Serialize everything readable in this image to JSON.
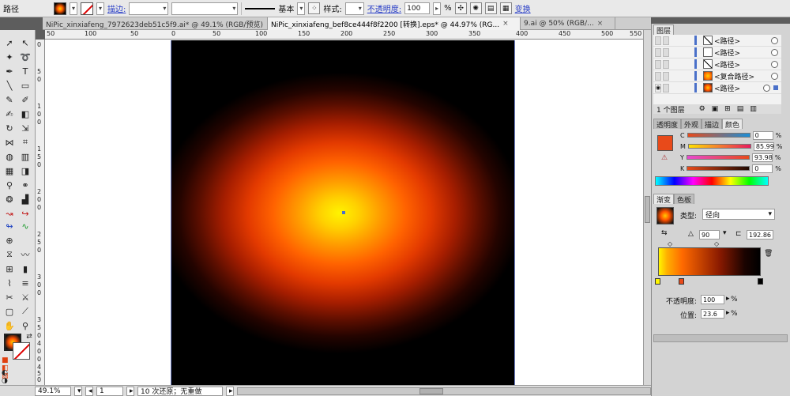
{
  "control_bar": {
    "object_type": "路径",
    "stroke_label": "描边:",
    "stroke_profile": "基本",
    "style_label": "样式:",
    "opacity_label": "不透明度:",
    "opacity_value": "100",
    "opacity_unit": "%",
    "transform_label": "变换"
  },
  "tabs": [
    {
      "label": "NiPic_xinxiafeng_7972623deb51c5f9.ai* @ 49.1% (RGB/预览)",
      "close": "×"
    },
    {
      "label": "NiPic_xinxiafeng_bef8ce444f8f2200 [转换].eps* @ 44.97% (RG...",
      "close": "×"
    },
    {
      "label": "9.ai @ 50% (RGB/...",
      "close": "×"
    }
  ],
  "ruler_top": [
    "50",
    "100",
    "50",
    "0",
    "50",
    "100",
    "150",
    "200",
    "250",
    "300",
    "350",
    "400",
    "450",
    "500",
    "550"
  ],
  "ruler_left": [
    "0",
    "5",
    "0",
    "1",
    "0",
    "0",
    "1",
    "5",
    "0",
    "2",
    "0",
    "0",
    "2",
    "5",
    "0",
    "3",
    "0",
    "0",
    "3",
    "5",
    "0",
    "4",
    "0",
    "0",
    "4",
    "5",
    "0"
  ],
  "status": {
    "zoom": "49.1%",
    "page": "1",
    "message": "10 次还原；无重做"
  },
  "layers_panel": {
    "tab": "图层",
    "rows": [
      {
        "name": "<路径>",
        "thumb": "slash"
      },
      {
        "name": "<路径>",
        "thumb": "blank"
      },
      {
        "name": "<路径>",
        "thumb": "blank"
      },
      {
        "name": "<复合路径>",
        "thumb": "orange"
      },
      {
        "name": "<路径>",
        "thumb": "grad"
      }
    ],
    "footer": "1 个图层"
  },
  "color_panel": {
    "tabs": [
      "透明度",
      "外观",
      "描边",
      "颜色"
    ],
    "swatch_color": "#e84a1a",
    "channels": [
      {
        "label": "C",
        "value": "0"
      },
      {
        "label": "M",
        "value": "85.99"
      },
      {
        "label": "Y",
        "value": "93.98"
      },
      {
        "label": "K",
        "value": "0"
      }
    ],
    "unit": "%"
  },
  "gradient_panel": {
    "tabs": [
      "渐变",
      "色板"
    ],
    "type_label": "类型:",
    "type_value": "径向",
    "angle_value": "90",
    "aspect_value": "192.86",
    "opacity_label": "不透明度:",
    "opacity_value": "100",
    "location_label": "位置:",
    "location_value": "23.6",
    "unit": "%"
  },
  "colors": {
    "accent_blue": "#4a70c9",
    "link_blue": "#2a3fc7"
  }
}
